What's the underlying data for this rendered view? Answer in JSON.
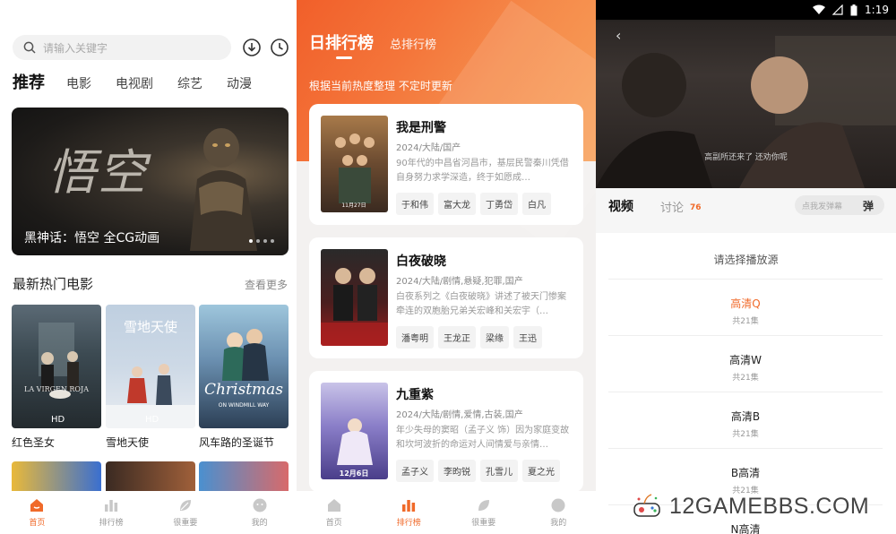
{
  "home": {
    "search_placeholder": "请输入关键字",
    "tabs": [
      "推荐",
      "电影",
      "电视剧",
      "综艺",
      "动漫"
    ],
    "banner_calligraphy": "悟空",
    "banner_caption": "黑神话：悟空 全CG动画",
    "section_title": "最新热门电影",
    "section_more": "查看更多",
    "movies": [
      {
        "title": "红色圣女",
        "poster_text": "LA VIRGEN ROJA",
        "badge": "HD"
      },
      {
        "title": "雪地天使",
        "poster_text": "雪地天使",
        "badge": "HD"
      },
      {
        "title": "风车路的圣诞节",
        "poster_text": "Christmas",
        "poster_sub": "ON WINDMILL WAY",
        "badge": ""
      }
    ],
    "nav": [
      "首页",
      "排行榜",
      "很重要",
      "我的"
    ],
    "nav_active": 0
  },
  "ranking": {
    "tab_daily": "日排行榜",
    "tab_total": "总排行榜",
    "subtitle": "根据当前热度整理 不定时更新",
    "items": [
      {
        "title": "我是刑警",
        "meta": "2024/大陆/国产",
        "desc": "90年代的中昌省河昌市，基层民警秦川凭借自身努力求学深造，终于如愿成…",
        "cast": [
          "于和伟",
          "富大龙",
          "丁勇岱",
          "白凡"
        ],
        "poster_date": "11月27日"
      },
      {
        "title": "白夜破晓",
        "meta": "2024/大陆/剧情,悬疑,犯罪,国产",
        "desc": "白夜系列之《白夜破晓》讲述了被天门惨案牵连的双胞胎兄弟关宏峰和关宏宇（…",
        "cast": [
          "潘粤明",
          "王龙正",
          "梁缘",
          "王迅"
        ],
        "poster_date": ""
      },
      {
        "title": "九重紫",
        "meta": "2024/大陆/剧情,爱情,古装,国产",
        "desc": "年少失母的窦昭（孟子义 饰）因为家庭变故和坎坷波折的命运对人间情爱与亲情…",
        "cast": [
          "孟子义",
          "李昀锐",
          "孔雪儿",
          "夏之光"
        ],
        "poster_date": "12月6日"
      }
    ],
    "nav": [
      "首页",
      "排行榜",
      "很重要",
      "我的"
    ],
    "nav_active": 1
  },
  "player": {
    "status_time": "1:19",
    "subtitle_line": "高副所还来了  还劝你呢",
    "tab_video": "视频",
    "tab_comment": "讨论",
    "comment_count": "76",
    "danmaku_placeholder": "点我发弹幕",
    "danmaku_btn": "弹",
    "sheet_title": "请选择播放源",
    "sources": [
      {
        "name": "高清Q",
        "episodes": "共21集",
        "selected": true
      },
      {
        "name": "高清W",
        "episodes": "共21集",
        "selected": false
      },
      {
        "name": "高清B",
        "episodes": "共21集",
        "selected": false
      },
      {
        "name": "B高清",
        "episodes": "共21集",
        "selected": false
      },
      {
        "name": "N高清",
        "episodes": "",
        "selected": false
      }
    ]
  },
  "watermark": "12GAMEBBS.COM",
  "colors": {
    "accent": "#f06a2a",
    "header_gradient_start": "#f15f2a",
    "header_gradient_end": "#f8a15a"
  }
}
